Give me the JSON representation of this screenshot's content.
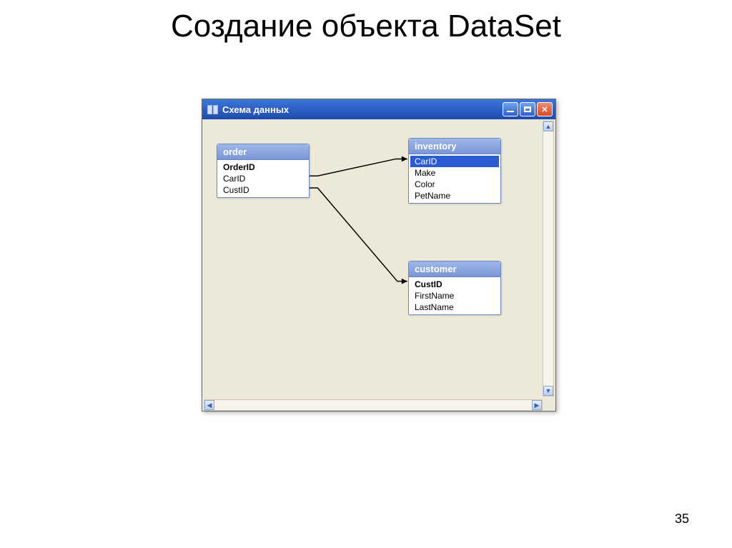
{
  "slide": {
    "title": "Создание объекта DataSet",
    "page_number": "35"
  },
  "window": {
    "title": "Схема данных",
    "buttons": {
      "minimize": "minimize",
      "maximize": "maximize",
      "close": "close"
    }
  },
  "tables": {
    "order": {
      "name": "order",
      "fields": [
        "OrderID",
        "CarID",
        "CustID"
      ],
      "pk_index": 0
    },
    "inventory": {
      "name": "inventory",
      "fields": [
        "CarID",
        "Make",
        "Color",
        "PetName"
      ],
      "selected_index": 0
    },
    "customer": {
      "name": "customer",
      "fields": [
        "CustID",
        "FirstName",
        "LastName"
      ],
      "pk_index": 0
    }
  },
  "relationships": [
    {
      "from": "order.CarID",
      "to": "inventory.CarID"
    },
    {
      "from": "order.CustID",
      "to": "customer.CustID"
    }
  ],
  "scroll": {
    "up": "▲",
    "down": "▼",
    "left": "◀",
    "right": "▶"
  }
}
